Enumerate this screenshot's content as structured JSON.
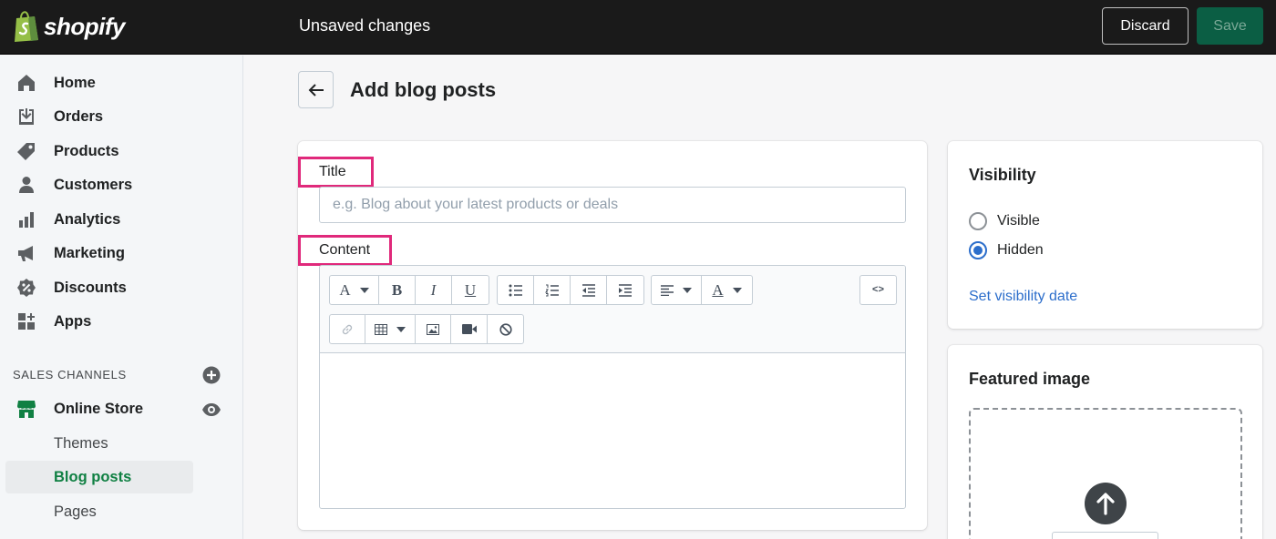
{
  "topbar": {
    "brand": "shopify",
    "status": "Unsaved changes",
    "discard_label": "Discard",
    "save_label": "Save"
  },
  "sidebar": {
    "items": [
      {
        "label": "Home",
        "icon": "home-icon"
      },
      {
        "label": "Orders",
        "icon": "orders-icon"
      },
      {
        "label": "Products",
        "icon": "tag-icon"
      },
      {
        "label": "Customers",
        "icon": "person-icon"
      },
      {
        "label": "Analytics",
        "icon": "bar-chart-icon"
      },
      {
        "label": "Marketing",
        "icon": "megaphone-icon"
      },
      {
        "label": "Discounts",
        "icon": "discount-icon"
      },
      {
        "label": "Apps",
        "icon": "apps-icon"
      }
    ],
    "sales_channels_title": "SALES CHANNELS",
    "online_store_label": "Online Store",
    "sub_items": [
      {
        "label": "Themes",
        "active": false
      },
      {
        "label": "Blog posts",
        "active": true
      },
      {
        "label": "Pages",
        "active": false
      }
    ]
  },
  "page": {
    "title": "Add blog posts"
  },
  "form": {
    "title_label": "Title",
    "title_placeholder": "e.g. Blog about your latest products or deals",
    "title_value": "",
    "content_label": "Content",
    "content_value": ""
  },
  "visibility": {
    "heading": "Visibility",
    "options": [
      {
        "label": "Visible",
        "selected": false
      },
      {
        "label": "Hidden",
        "selected": true
      }
    ],
    "set_date_link": "Set visibility date"
  },
  "featured_image": {
    "heading": "Featured image"
  },
  "colors": {
    "topbar_bg": "#1a1a1a",
    "save_button": "#0b5e44",
    "active_nav": "#108043",
    "highlight_box": "#e0297b",
    "link": "#2c6ecb"
  }
}
